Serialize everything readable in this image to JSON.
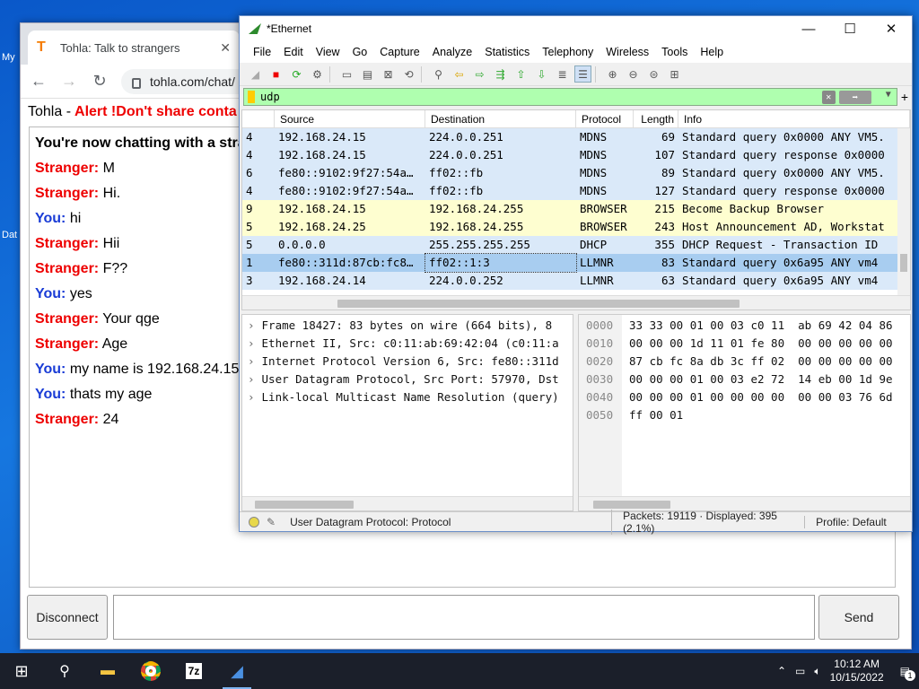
{
  "desktop": {
    "icons": [
      {
        "label": "My"
      },
      {
        "label": "Dat"
      }
    ]
  },
  "browser": {
    "tab_title": "Tohla: Talk to strangers",
    "url": "tohla.com/chat/",
    "page_title": "Tohla -",
    "alert": "Alert !Don't share conta",
    "chat": [
      {
        "who": "",
        "text": "You're now chatting with a stra"
      },
      {
        "who": "Stranger:",
        "text": "M",
        "type": "s"
      },
      {
        "who": "Stranger:",
        "text": "Hi.",
        "type": "s"
      },
      {
        "who": "You:",
        "text": "hi",
        "type": "y"
      },
      {
        "who": "Stranger:",
        "text": "Hii",
        "type": "s"
      },
      {
        "who": "Stranger:",
        "text": "F??",
        "type": "s"
      },
      {
        "who": "You:",
        "text": "yes",
        "type": "y"
      },
      {
        "who": "Stranger:",
        "text": "Your qge",
        "type": "s"
      },
      {
        "who": "Stranger:",
        "text": "Age",
        "type": "s"
      },
      {
        "who": "You:",
        "text": "my name is 192.168.24.15",
        "type": "y"
      },
      {
        "who": "You:",
        "text": "thats my age",
        "type": "y"
      },
      {
        "who": "Stranger:",
        "text": "24",
        "type": "s"
      }
    ],
    "disconnect_label": "Disconnect",
    "send_label": "Send"
  },
  "wireshark": {
    "title": "*Ethernet",
    "menu": [
      "File",
      "Edit",
      "View",
      "Go",
      "Capture",
      "Analyze",
      "Statistics",
      "Telephony",
      "Wireless",
      "Tools",
      "Help"
    ],
    "filter": "udp",
    "columns": [
      "",
      "Source",
      "Destination",
      "Protocol",
      "Length",
      "Info"
    ],
    "packets": [
      {
        "no": "4",
        "src": "192.168.24.15",
        "dst": "224.0.0.251",
        "proto": "MDNS",
        "len": "69",
        "info": "Standard query 0x0000 ANY VM5.",
        "bg": "#dae9f9"
      },
      {
        "no": "4",
        "src": "192.168.24.15",
        "dst": "224.0.0.251",
        "proto": "MDNS",
        "len": "107",
        "info": "Standard query response 0x0000",
        "bg": "#dae9f9"
      },
      {
        "no": "6",
        "src": "fe80::9102:9f27:54a…",
        "dst": "ff02::fb",
        "proto": "MDNS",
        "len": "89",
        "info": "Standard query 0x0000 ANY VM5.",
        "bg": "#dae9f9"
      },
      {
        "no": "4",
        "src": "fe80::9102:9f27:54a…",
        "dst": "ff02::fb",
        "proto": "MDNS",
        "len": "127",
        "info": "Standard query response 0x0000",
        "bg": "#dae9f9"
      },
      {
        "no": "9",
        "src": "192.168.24.15",
        "dst": "192.168.24.255",
        "proto": "BROWSER",
        "len": "215",
        "info": "Become Backup Browser",
        "bg": "#fefed0"
      },
      {
        "no": "5",
        "src": "192.168.24.25",
        "dst": "192.168.24.255",
        "proto": "BROWSER",
        "len": "243",
        "info": "Host Announcement AD, Workstat",
        "bg": "#fefed0"
      },
      {
        "no": "5",
        "src": "0.0.0.0",
        "dst": "255.255.255.255",
        "proto": "DHCP",
        "len": "355",
        "info": "DHCP Request  - Transaction ID",
        "bg": "#dae9f9"
      },
      {
        "no": "1",
        "src": "fe80::311d:87cb:fc8…",
        "dst": "ff02::1:3",
        "proto": "LLMNR",
        "len": "83",
        "info": "Standard query 0x6a95 ANY vm4",
        "bg": "#a8cdf0"
      },
      {
        "no": "3",
        "src": "192.168.24.14",
        "dst": "224.0.0.252",
        "proto": "LLMNR",
        "len": "63",
        "info": "Standard query 0x6a95 ANY vm4",
        "bg": "#dae9f9"
      }
    ],
    "details": [
      "Frame 18427: 83 bytes on wire (664 bits), 8",
      "Ethernet II, Src: c0:11:ab:69:42:04 (c0:11:a",
      "Internet Protocol Version 6, Src: fe80::311d",
      "User Datagram Protocol, Src Port: 57970, Dst",
      "Link-local Multicast Name Resolution (query)"
    ],
    "hex_offsets": [
      "0000",
      "0010",
      "0020",
      "0030",
      "0040",
      "0050"
    ],
    "hex_rows": [
      "33 33 00 01 00 03 c0 11  ab 69 42 04 86",
      "00 00 00 1d 11 01 fe 80  00 00 00 00 00",
      "87 cb fc 8a db 3c ff 02  00 00 00 00 00",
      "00 00 00 01 00 03 e2 72  14 eb 00 1d 9e",
      "00 00 00 01 00 00 00 00  00 00 03 76 6d",
      "ff 00 01"
    ],
    "status_field": "User Datagram Protocol: Protocol",
    "status_packets": "Packets: 19119 · Displayed: 395 (2.1%)",
    "status_profile": "Profile: Default"
  },
  "taskbar": {
    "time": "10:12 AM",
    "date": "10/15/2022",
    "notif_count": "1"
  }
}
